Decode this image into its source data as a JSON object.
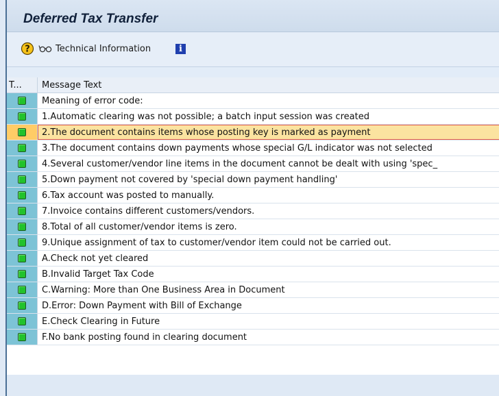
{
  "window": {
    "title": "Deferred Tax Transfer"
  },
  "toolbar": {
    "help_icon": "help-question-icon",
    "technical_information_label": "Technical Information",
    "info_icon_letter": "i"
  },
  "table": {
    "columns": [
      "T...",
      "Message Text"
    ],
    "rows": [
      {
        "status": "green-led",
        "text": "Meaning of error code:"
      },
      {
        "status": "green-led",
        "text": "1.Automatic clearing was not possible; a batch input session was created"
      },
      {
        "status": "green-led",
        "text": "2.The document contains items whose posting key is marked as payment"
      },
      {
        "status": "green-led",
        "text": "3.The document contains down payments whose special G/L indicator was not selected"
      },
      {
        "status": "green-led",
        "text": "4.Several customer/vendor line items in the document cannot be dealt with using 'spec_"
      },
      {
        "status": "green-led",
        "text": "5.Down payment not covered by 'special down payment handling'"
      },
      {
        "status": "green-led",
        "text": "6.Tax account was posted to manually."
      },
      {
        "status": "green-led",
        "text": "7.Invoice contains different customers/vendors."
      },
      {
        "status": "green-led",
        "text": "8.Total of all customer/vendor items is zero."
      },
      {
        "status": "green-led",
        "text": "9.Unique assignment of tax to customer/vendor item could not be carried out."
      },
      {
        "status": "green-led",
        "text": "A.Check not yet cleared"
      },
      {
        "status": "green-led",
        "text": "B.Invalid Target Tax Code"
      },
      {
        "status": "green-led",
        "text": "C.Warning: More than One Business Area in Document"
      },
      {
        "status": "green-led",
        "text": "D.Error: Down Payment with Bill of Exchange"
      },
      {
        "status": "green-led",
        "text": "E.Check Clearing in Future"
      },
      {
        "status": "green-led",
        "text": "F.No bank posting found in clearing document"
      }
    ],
    "selected_row": 2
  },
  "colors": {
    "status_led_green": "#22c22c",
    "selected_row_bg": "#fbe3a0",
    "status_col_bg": "#7dc3d6"
  }
}
